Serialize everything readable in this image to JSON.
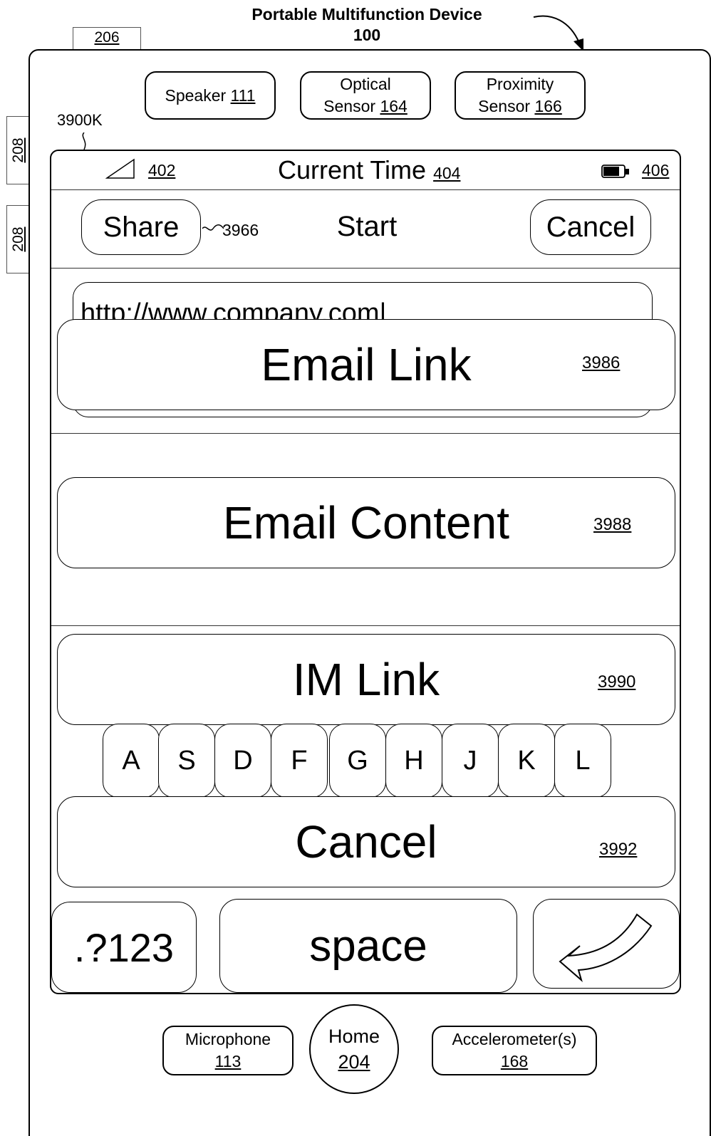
{
  "figure": {
    "title": "Portable Multifunction Device",
    "device_ref": "100",
    "ref_206": "206",
    "ref_208": "208",
    "ref_208b": "208",
    "ref_3900k": "3900K"
  },
  "hardware": {
    "speaker_label": "Speaker",
    "speaker_ref": "111",
    "optical_label": "Optical",
    "optical_label2": "Sensor",
    "optical_ref": "164",
    "proximity_label": "Proximity",
    "proximity_label2": "Sensor",
    "proximity_ref": "166",
    "microphone_label": "Microphone",
    "microphone_ref": "113",
    "home_label": "Home",
    "home_ref": "204",
    "accelerometer_label": "Accelerometer(s)",
    "accelerometer_ref": "168"
  },
  "status_bar": {
    "signal_ref": "402",
    "time_label": "Current Time",
    "time_ref": "404",
    "battery_ref": "406"
  },
  "nav_bar": {
    "share_label": "Share",
    "share_ref": "3966",
    "title": "Start",
    "cancel_label": "Cancel"
  },
  "url_field": {
    "value": "http://www.company.com|"
  },
  "action_sheet": {
    "email_link_label": "Email Link",
    "email_link_ref": "3986",
    "email_content_label": "Email Content",
    "email_content_ref": "3988",
    "im_link_label": "IM Link",
    "im_link_ref": "3990",
    "cancel_label": "Cancel",
    "cancel_ref": "3992"
  },
  "keyboard": {
    "row_keys": [
      "A",
      "S",
      "D",
      "F",
      "G",
      "H",
      "J",
      "K",
      "L"
    ],
    "numbers_label": ".?123",
    "space_label": "space",
    "return_icon": "return-arrow-icon"
  }
}
